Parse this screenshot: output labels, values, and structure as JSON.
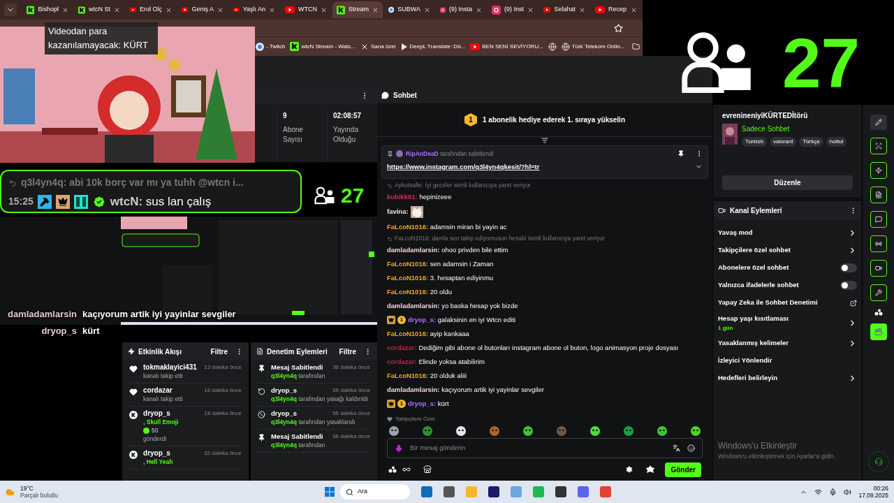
{
  "browser": {
    "tabs": [
      {
        "kind": "kick",
        "label": "Bishopl",
        "selected": false
      },
      {
        "kind": "kick",
        "label": "wtcN St",
        "selected": false
      },
      {
        "kind": "youtube",
        "label": "Erol Olç",
        "selected": false
      },
      {
        "kind": "youtube",
        "label": "Geniş A",
        "selected": false
      },
      {
        "kind": "youtube",
        "label": "Yaşlı An",
        "selected": false
      },
      {
        "kind": "youtube",
        "label": "WTCN",
        "selected": false
      },
      {
        "kind": "kick",
        "label": "Stream",
        "selected": true
      },
      {
        "kind": "web",
        "label": "SUBWA",
        "selected": false
      },
      {
        "kind": "instagram",
        "label": "(9) Insta",
        "selected": false
      },
      {
        "kind": "instagram",
        "label": "(9) Inst",
        "selected": false
      },
      {
        "kind": "youtube",
        "label": "Selahat",
        "selected": false
      },
      {
        "kind": "youtube",
        "label": "Recep",
        "selected": false
      }
    ],
    "bookmarks": [
      {
        "kind": "web",
        "label": "- Twitch"
      },
      {
        "kind": "kick",
        "label": "wtcN Stream - Watc..."
      },
      {
        "kind": "x",
        "label": "Sana özel"
      },
      {
        "kind": "deepl",
        "label": "DeepL Translate: Dü..."
      },
      {
        "kind": "youtube",
        "label": "BEN SENİ SEVİYORU..."
      },
      {
        "kind": "globe"
      },
      {
        "kind": "globe",
        "label": "Türk Telekom Onlin..."
      }
    ]
  },
  "stream_overlay": {
    "tooltip": "Videodan para kazanılamayacak: KÜRT",
    "chat_box": {
      "reply": "q3l4yn4q: abi 10k borç var mı ya tuhh @wtcn i...",
      "time": "15:25",
      "user": "wtcN:",
      "message": "sus lan çalış"
    },
    "viewer_count": "27",
    "viewer_count_large": "27",
    "chat_lines": [
      {
        "user": "damladamlarsin",
        "message": "kaçıyorum artik iyi yayinlar sevgiler"
      },
      {
        "user": "dryop_s",
        "message": "kürt"
      }
    ]
  },
  "stats_panel": {
    "stats": [
      {
        "value": "9",
        "label": "Abone Sayısı"
      },
      {
        "value": "02:08:57",
        "label": "Yayında Olduğu"
      }
    ]
  },
  "event_feed": {
    "title": "Etkinlik Akışı",
    "filter": "Filtre",
    "items": [
      {
        "kind": "follow",
        "user": "tokmaklayici431",
        "time": "13 dakika önce",
        "text": "kanalı takip etti"
      },
      {
        "kind": "follow",
        "user": "cordazar",
        "time": "16 dakika önce",
        "text": "kanalı takip etti"
      },
      {
        "kind": "gift",
        "user": "dryop_s",
        "time": "18 dakika önce",
        "item": ", Skull Emoji",
        "amount": "50",
        "text": "gönderdi"
      },
      {
        "kind": "gift",
        "user": "dryop_s",
        "time": "32 dakika önce",
        "item": ", Hell Yeah"
      }
    ]
  },
  "mod_actions": {
    "title": "Denetim Eylemleri",
    "filter": "Filtre",
    "items": [
      {
        "kind": "pin",
        "title": "Mesaj Sabitlendi",
        "time": "36 dakika önce",
        "by": "q3l4yn4q",
        "text": "tarafından"
      },
      {
        "kind": "unban",
        "title": "dryop_s",
        "time": "55 dakika önce",
        "by": "q3l4yn4q",
        "text": "tarafından yasağı kaldırıldı"
      },
      {
        "kind": "ban",
        "title": "dryop_s",
        "time": "55 dakika önce",
        "by": "q3l4yn4q",
        "text": "tarafından yasaklandı"
      },
      {
        "kind": "pin",
        "title": "Mesaj Sabitlendi",
        "time": "56 dakika önce",
        "by": "q3l4yn4q",
        "text": "tarafından"
      }
    ]
  },
  "chat": {
    "title": "Sohbet",
    "banner": {
      "badge": "1",
      "text": "1 abonelik hediye ederek 1. sıraya yükselin"
    },
    "pinned": {
      "user": "RipAnDeaD",
      "text": "tarafından sabitlendi",
      "link": "https://www.instagram.com/q3l4yn4qkesit/?hl=tr"
    },
    "messages": [
      {
        "kind": "reply",
        "text": "Aykutsafie: İyi geceler isimli kullanıcıya yanıt veriyor"
      },
      {
        "kind": "message",
        "user": "kubikk91:",
        "color": "#e0245e",
        "text": "hepinizeee"
      },
      {
        "kind": "emote",
        "user": "favina:",
        "color": "#f2e6d9"
      },
      {
        "kind": "message",
        "user": "FaLcoN1016:",
        "color": "#f5a623",
        "text": "adamsin miran bi yayin ac"
      },
      {
        "kind": "reply",
        "text": "FaLcoN1016: damla sen takip ediyomusun hesabi isimli kullanıcıya yanıt veriyor"
      },
      {
        "kind": "message",
        "user": "damladamlarsin:",
        "color": "#f3d6e0",
        "text": "ohoo privden bile ettim"
      },
      {
        "kind": "message",
        "user": "FaLcoN1016:",
        "color": "#f5a623",
        "text": "sen adamsin i Zaman"
      },
      {
        "kind": "message",
        "user": "FaLcoN1016:",
        "color": "#f5a623",
        "text": "3. hesaptan ediyinmu"
      },
      {
        "kind": "message",
        "user": "FaLcoN1016:",
        "color": "#f5a623",
        "text": "20 oldu"
      },
      {
        "kind": "message",
        "user": "damladamlarsin:",
        "color": "#f3d6e0",
        "text": "yo baska hesap yok bizde"
      },
      {
        "kind": "message",
        "user": "dryop_s:",
        "color": "#a970ff",
        "badge": "1",
        "text": "galaksinin en iyi Wtcn editi"
      },
      {
        "kind": "message",
        "user": "FaLcoN1016:",
        "color": "#f5a623",
        "text": "ayip kankaaa"
      },
      {
        "kind": "message",
        "user": "cordazar:",
        "color": "#c8213f",
        "text": "Dediğim gibi abone ol butonları instagram abone ol buton, logo animasyon proje dosyası"
      },
      {
        "kind": "message",
        "user": "cordazar:",
        "color": "#c8213f",
        "text": "Elinde yoksa atabilirim"
      },
      {
        "kind": "message",
        "user": "FaLcoN1016:",
        "color": "#f5a623",
        "text": "20 olduk aliii"
      },
      {
        "kind": "message",
        "user": "damladamlarsin:",
        "color": "#f3d6e0",
        "text": "kaçıyorum artik iyi yayinlar sevgiler"
      },
      {
        "kind": "message",
        "user": "dryop_s:",
        "color": "#a970ff",
        "badge": "1",
        "text": "kürt"
      }
    ],
    "followers_label": "Takipçilere Özel",
    "placeholder": "Bir mesaj gönderin",
    "send": "Gönder"
  },
  "channel": {
    "title": "evrenineniyiKÜRTEDİtörü",
    "mode": "Sadece Sohbet",
    "tags": [
      "Turkish",
      "valorant",
      "Türkçe",
      "hottul"
    ],
    "edit": "Düzenle"
  },
  "channel_actions": {
    "title": "Kanal Eylemleri",
    "items": [
      {
        "kind": "arrow",
        "label": "Yavaş mod"
      },
      {
        "kind": "arrow",
        "label": "Takipçilere özel sohbet"
      },
      {
        "kind": "toggle",
        "label": "Abonelere özel sohbet",
        "on": false
      },
      {
        "kind": "toggle",
        "label": "Yalnızca ifadelerle sohbet",
        "on": false
      },
      {
        "kind": "external",
        "label": "Yapay Zeka ile Sohbet Denetimi"
      },
      {
        "kind": "arrow",
        "label": "Hesap yaşı kısıtlaması",
        "sub": "1 gün"
      },
      {
        "kind": "arrow",
        "label": "Yasaklanmış kelimeler"
      },
      {
        "kind": "plain",
        "label": "İzleyici Yönlendir"
      },
      {
        "kind": "arrow",
        "label": "Hedefleri belirleyin"
      }
    ]
  },
  "windows_activation": {
    "title": "Windows'u Etkinleştir",
    "text": "Windows'u etkinleştirmek için Ayarlar'a gidin."
  },
  "taskbar": {
    "temperature": "19°C",
    "weather": "Parçalı bulutlu",
    "search": "Ara",
    "time": "00:26",
    "date": "17.09.2025"
  }
}
